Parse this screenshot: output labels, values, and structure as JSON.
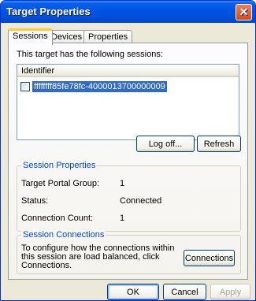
{
  "window": {
    "title": "Target Properties",
    "close_glyph": "✕"
  },
  "tabs": [
    {
      "label": "Sessions"
    },
    {
      "label": "Devices"
    },
    {
      "label": "Properties"
    }
  ],
  "sessions": {
    "intro": "This target has the following sessions:",
    "column_header": "Identifier",
    "rows": [
      {
        "identifier": "ffffffff85fe78fc-4000013700000009",
        "checked": false,
        "selected": true
      }
    ],
    "logoff_label": "Log off...",
    "refresh_label": "Refresh"
  },
  "session_properties": {
    "title": "Session Properties",
    "portal_group_label": "Target Portal Group:",
    "portal_group_value": "1",
    "status_label": "Status:",
    "status_value": "Connected",
    "connection_count_label": "Connection Count:",
    "connection_count_value": "1"
  },
  "session_connections": {
    "title": "Session Connections",
    "description_line1": "To configure how the connections within",
    "description_line2": "this session are load balanced, click",
    "description_line3": "Connections.",
    "connections_label": "Connections"
  },
  "footer": {
    "ok_label": "OK",
    "cancel_label": "Cancel",
    "apply_label": "Apply"
  },
  "colors": {
    "title_bar": "#0054e3",
    "selection": "#316ac5",
    "group_title": "#0046d5",
    "active_tab_accent": "#ffc83c"
  }
}
